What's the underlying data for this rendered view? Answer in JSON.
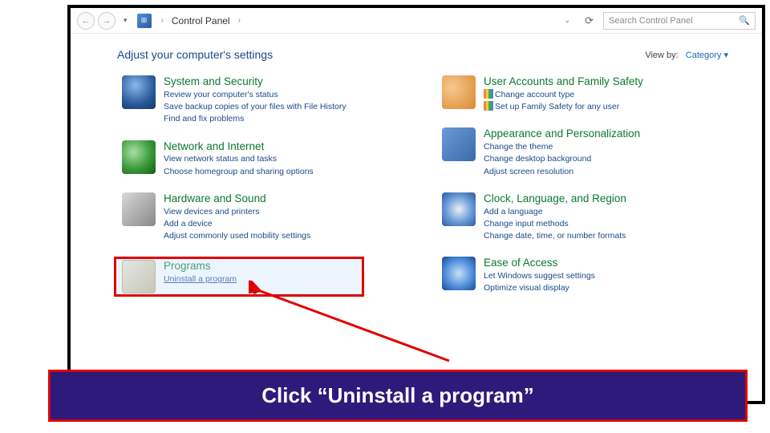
{
  "toolbar": {
    "breadcrumb": "Control Panel",
    "search_placeholder": "Search Control Panel"
  },
  "view": {
    "label": "View by:",
    "value": "Category"
  },
  "heading": "Adjust your computer's settings",
  "left": [
    {
      "title": "System and Security",
      "links": [
        "Review your computer's status",
        "Save backup copies of your files with File History",
        "Find and fix problems"
      ]
    },
    {
      "title": "Network and Internet",
      "links": [
        "View network status and tasks",
        "Choose homegroup and sharing options"
      ]
    },
    {
      "title": "Hardware and Sound",
      "links": [
        "View devices and printers",
        "Add a device",
        "Adjust commonly used mobility settings"
      ]
    },
    {
      "title": "Programs",
      "links": [
        "Uninstall a program"
      ]
    }
  ],
  "right": [
    {
      "title": "User Accounts and Family Safety",
      "links": [
        "Change account type",
        "Set up Family Safety for any user"
      ],
      "shield": true
    },
    {
      "title": "Appearance and Personalization",
      "links": [
        "Change the theme",
        "Change desktop background",
        "Adjust screen resolution"
      ]
    },
    {
      "title": "Clock, Language, and Region",
      "links": [
        "Add a language",
        "Change input methods",
        "Change date, time, or number formats"
      ]
    },
    {
      "title": "Ease of Access",
      "links": [
        "Let Windows suggest settings",
        "Optimize visual display"
      ]
    }
  ],
  "callout": "Click “Uninstall a program”"
}
